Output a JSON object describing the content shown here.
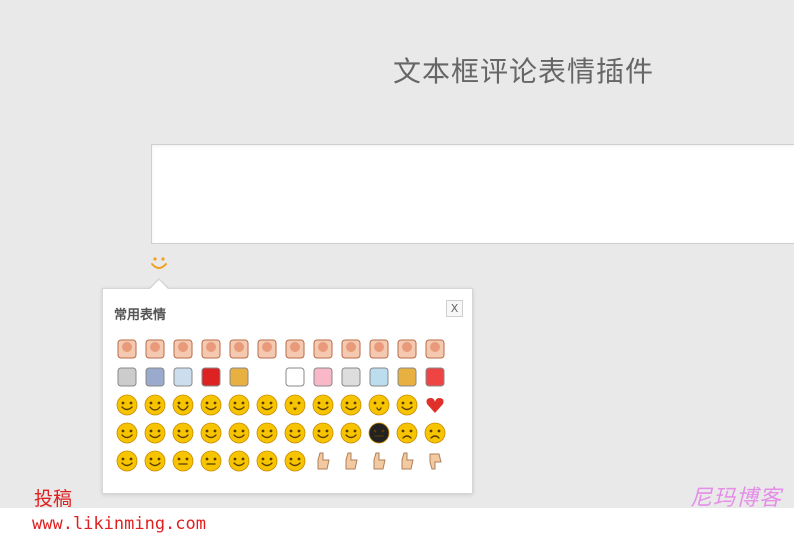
{
  "page": {
    "title": "文本框评论表情插件"
  },
  "comment_box": {
    "value": "",
    "placeholder": ""
  },
  "emoji_trigger": {
    "icon": "smile-icon",
    "color": "#f0a020"
  },
  "emoji_popup": {
    "title": "常用表情",
    "close_label": "X",
    "rows": [
      [
        "meme-face",
        "meme-face",
        "meme-face",
        "meme-face",
        "meme-face",
        "meme-face",
        "meme-face",
        "meme-face",
        "meme-face",
        "meme-face",
        "meme-face",
        "meme-face"
      ],
      [
        "animal-face",
        "square-icon",
        "cloud-icon",
        "red-square",
        "pixel-face",
        "blank",
        "panda-face",
        "pig-face",
        "globe-face",
        "house-icon",
        "pixel-face",
        "gift-icon"
      ],
      [
        "smile",
        "grin",
        "laugh",
        "smile",
        "cry",
        "awkward",
        "surprised",
        "smirk",
        "pout",
        "shock",
        "cover-face",
        "heart"
      ],
      [
        "tears",
        "shy",
        "scream",
        "sweat",
        "sleepy",
        "dizzy",
        "angry",
        "confused",
        "wonder",
        "dark-face",
        "sad",
        "frown"
      ],
      [
        "cry-hard",
        "think",
        "meh",
        "meh",
        "money",
        "cool",
        "love",
        "ok-hand",
        "thumbs-up",
        "victory",
        "thumbs-up",
        "thumbs-down"
      ]
    ]
  },
  "footer": {
    "label": "投稿",
    "url": "www.likinming.com",
    "watermark": "尼玛博客"
  },
  "colors": {
    "background": "#e9e9e9",
    "accent": "#e02020",
    "watermark": "#e58ee8"
  }
}
